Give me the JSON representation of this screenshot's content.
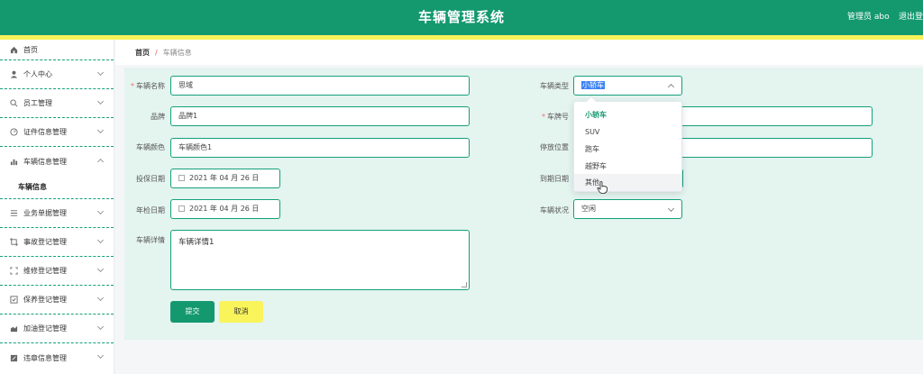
{
  "header": {
    "title": "车辆管理系统",
    "admin_label": "管理员 abo",
    "logout_label": "退出登录"
  },
  "sidebar": {
    "items": [
      {
        "label": "首页",
        "icon": "home-icon"
      },
      {
        "label": "个人中心",
        "icon": "user-icon"
      },
      {
        "label": "员工管理",
        "icon": "staff-icon"
      },
      {
        "label": "证件信息管理",
        "icon": "certificate-icon"
      },
      {
        "label": "车辆信息管理",
        "icon": "bar-chart-icon"
      },
      {
        "label": "业务单据管理",
        "icon": "list-icon"
      },
      {
        "label": "事故登记管理",
        "icon": "crop-icon"
      },
      {
        "label": "维修登记管理",
        "icon": "fullscreen-icon"
      },
      {
        "label": "保养登记管理",
        "icon": "checkbox-icon"
      },
      {
        "label": "加油登记管理",
        "icon": "fuel-icon"
      },
      {
        "label": "违章信息管理",
        "icon": "edit-icon"
      }
    ],
    "active_sub": "车辆信息"
  },
  "breadcrumb": {
    "home": "首页",
    "separator": "/",
    "current": "车辆信息"
  },
  "form": {
    "vehicle_name_label": "车辆名称",
    "vehicle_name_value": "思域",
    "brand_label": "品牌",
    "brand_value": "品牌1",
    "color_label": "车辆颜色",
    "color_value": "车辆颜色1",
    "insure_date_label": "投保日期",
    "insure_date_value": "2021 年 04 月 26 日",
    "inspect_date_label": "年检日期",
    "inspect_date_value": "2021 年 04 月 26 日",
    "detail_label": "车辆详情",
    "detail_value": "车辆详情1",
    "vehicle_type_label": "车辆类型",
    "vehicle_type_value": "小轿车",
    "plate_label": "车牌号",
    "park_label": "停放位置",
    "expire_label": "到期日期",
    "status_label": "车辆状况",
    "status_value": "空闲",
    "submit_label": "提交",
    "cancel_label": "取消"
  },
  "dropdown": {
    "options": [
      "小轿车",
      "SUV",
      "跑车",
      "越野车",
      "其他"
    ],
    "selected": "小轿车",
    "hovered": "其他"
  },
  "colors": {
    "primary": "#14996f",
    "accent_yellow": "#f7f25a",
    "panel_bg": "#e4f4ef",
    "required": "#f56c6c"
  }
}
